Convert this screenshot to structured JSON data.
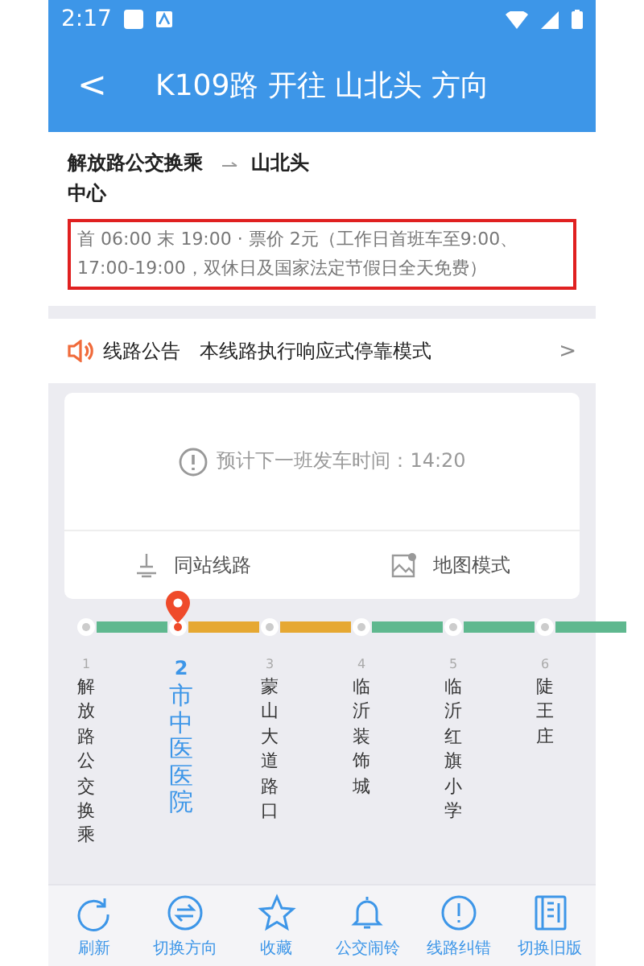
{
  "status_bar": {
    "time": "2:17"
  },
  "header": {
    "back": "<",
    "title": "K109路 开往 山北头 方向"
  },
  "route": {
    "from": "解放路公交换乘中心",
    "to": "山北头",
    "schedule": "首 06:00 末 19:00 · 票价 2元（工作日首班车至9:00、17:00-19:00，双休日及国家法定节假日全天免费）",
    "highlighted": true
  },
  "notice": {
    "label": "线路公告",
    "text": "本线路执行响应式停靠模式",
    "chevron": ">"
  },
  "next_departure": {
    "text": "预计下一班发车时间：14:20"
  },
  "card_actions": [
    {
      "kind": "routes",
      "label": "同站线路"
    },
    {
      "kind": "map",
      "label": "地图模式"
    }
  ],
  "stations": [
    {
      "number": "1",
      "name": "解放路公交换乘",
      "selected": false,
      "color": "#5fb88f"
    },
    {
      "number": "2",
      "name": "市中医医院",
      "selected": true,
      "color": "#e6a832"
    },
    {
      "number": "3",
      "name": "蒙山大道路口",
      "selected": false,
      "color": "#e6a832"
    },
    {
      "number": "4",
      "name": "临沂装饰城",
      "selected": false,
      "color": "#5fb88f"
    },
    {
      "number": "5",
      "name": "临沂红旗小学",
      "selected": false,
      "color": "#5fb88f"
    },
    {
      "number": "6",
      "name": "陡王庄",
      "selected": false,
      "color": "#5fb88f"
    }
  ],
  "toolbar": [
    {
      "kind": "refresh",
      "label": "刷新"
    },
    {
      "kind": "switch",
      "label": "切换方向"
    },
    {
      "kind": "star",
      "label": "收藏"
    },
    {
      "kind": "bell",
      "label": "公交闹铃"
    },
    {
      "kind": "alert",
      "label": "线路纠错"
    },
    {
      "kind": "layout",
      "label": "切换旧版"
    }
  ]
}
